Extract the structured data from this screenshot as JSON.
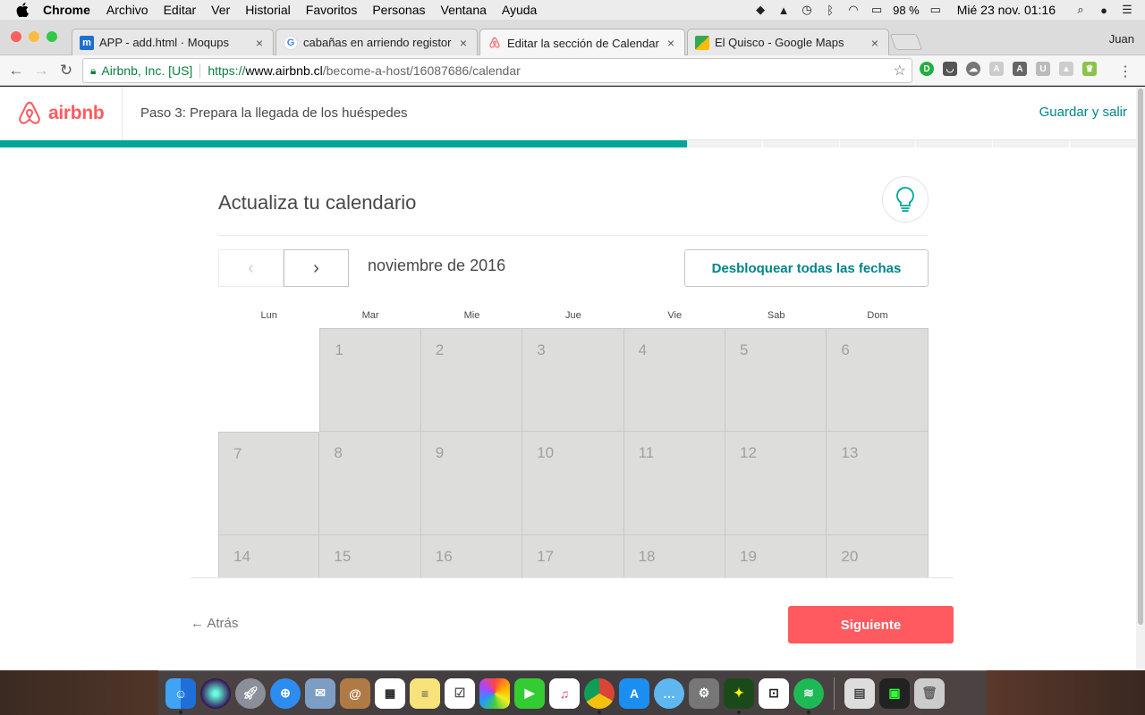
{
  "menubar": {
    "app": "Chrome",
    "items": [
      "Archivo",
      "Editar",
      "Ver",
      "Historial",
      "Favoritos",
      "Personas",
      "Ventana",
      "Ayuda"
    ],
    "battery": "98 %",
    "clock": "Mié 23 nov.  01:16"
  },
  "tabs": [
    {
      "label": "APP - add.html · Moqups",
      "favicon": "m",
      "favicon_color": "#1f6fd1"
    },
    {
      "label": "cabañas en arriendo registor -",
      "favicon": "G",
      "favicon_color": "#4285f4"
    },
    {
      "label": "Editar la sección de Calendario",
      "favicon": "airbnb",
      "favicon_color": "#ff5a5f"
    },
    {
      "label": "El Quisco - Google Maps",
      "favicon": "maps",
      "favicon_color": "#34a853"
    }
  ],
  "profile_name": "Juan",
  "address": {
    "secure_label": "Airbnb, Inc. [US]",
    "scheme": "https://",
    "host": "www.airbnb.cl",
    "path": "/become-a-host/16087686/calendar"
  },
  "host": {
    "logo_text": "airbnb",
    "step": "Paso 3: Prepara la llegada de los huéspedes",
    "save_exit": "Guardar y salir",
    "progress_fraction": 0.6
  },
  "calendar": {
    "title": "Actualiza tu calendario",
    "month": "noviembre de 2016",
    "unlock_label": "Desbloquear todas las fechas",
    "weekdays": [
      "Lun",
      "Mar",
      "Mie",
      "Jue",
      "Vie",
      "Sab",
      "Dom"
    ],
    "first_weekday_index": 1,
    "days": [
      1,
      2,
      3,
      4,
      5,
      6,
      7,
      8,
      9,
      10,
      11,
      12,
      13,
      14,
      15,
      16,
      17,
      18,
      19,
      20
    ]
  },
  "footer": {
    "back": "← Atrás",
    "next": "Siguiente"
  },
  "colors": {
    "brand": "#ff5a5f",
    "teal": "#008489",
    "progress": "#00a699",
    "blocked_day": "#dddedb"
  }
}
